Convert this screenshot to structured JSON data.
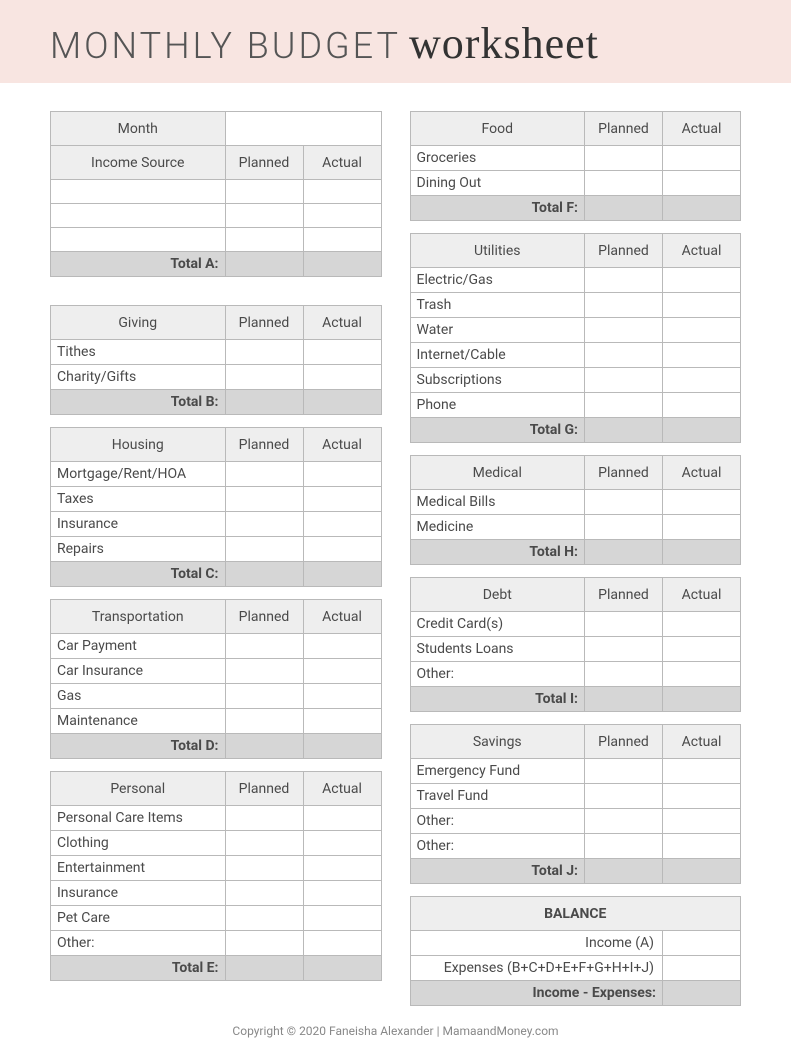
{
  "title_main": "MONTHLY BUDGET",
  "title_script": "worksheet",
  "headers": {
    "planned": "Planned",
    "actual": "Actual",
    "month": "Month",
    "income_source": "Income Source"
  },
  "left": [
    {
      "name": "Giving",
      "total": "Total B:",
      "items": [
        "Tithes",
        "Charity/Gifts"
      ]
    },
    {
      "name": "Housing",
      "total": "Total C:",
      "items": [
        "Mortgage/Rent/HOA",
        "Taxes",
        "Insurance",
        "Repairs"
      ]
    },
    {
      "name": "Transportation",
      "total": "Total D:",
      "items": [
        "Car Payment",
        "Car Insurance",
        "Gas",
        "Maintenance"
      ]
    },
    {
      "name": "Personal",
      "total": "Total E:",
      "items": [
        "Personal Care Items",
        "Clothing",
        "Entertainment",
        "Insurance",
        "Pet Care",
        "Other:"
      ]
    }
  ],
  "right": [
    {
      "name": "Food",
      "total": "Total F:",
      "items": [
        "Groceries",
        "Dining Out"
      ]
    },
    {
      "name": "Utilities",
      "total": "Total G:",
      "items": [
        "Electric/Gas",
        "Trash",
        "Water",
        "Internet/Cable",
        "Subscriptions",
        "Phone"
      ]
    },
    {
      "name": "Medical",
      "total": "Total H:",
      "items": [
        "Medical Bills",
        "Medicine"
      ]
    },
    {
      "name": "Debt",
      "total": "Total I:",
      "items": [
        "Credit Card(s)",
        "Students Loans",
        "Other:"
      ]
    },
    {
      "name": "Savings",
      "total": "Total J:",
      "items": [
        "Emergency Fund",
        "Travel Fund",
        "Other:",
        "Other:"
      ]
    }
  ],
  "income_total": "Total A:",
  "balance": {
    "title": "BALANCE",
    "income": "Income (A)",
    "expenses": "Expenses (B+C+D+E+F+G+H+I+J)",
    "net": "Income - Expenses:"
  },
  "footer": "Copyright © 2020 Faneisha Alexander | MamaandMoney.com"
}
